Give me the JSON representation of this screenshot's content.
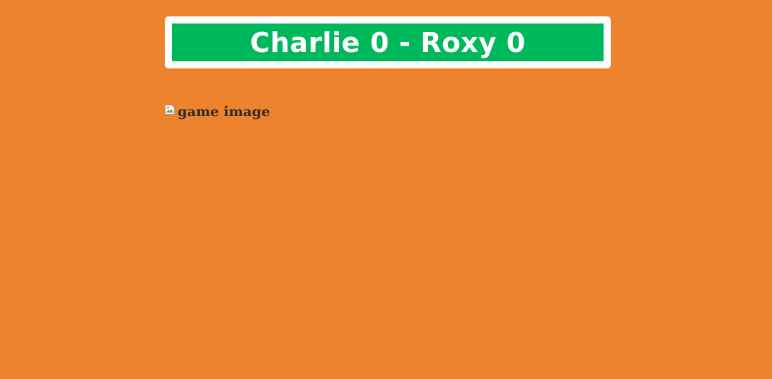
{
  "scoreboard": {
    "text": "Charlie 0 - Roxy 0"
  },
  "game_image": {
    "alt_text": "game image",
    "icon": "broken-image-icon"
  },
  "colors": {
    "background": "#ee832d",
    "scoreboard_border": "#ffffff",
    "scoreboard_fill": "#00b85c",
    "scoreboard_text": "#ffffff",
    "alt_text": "#2a2a2a"
  }
}
